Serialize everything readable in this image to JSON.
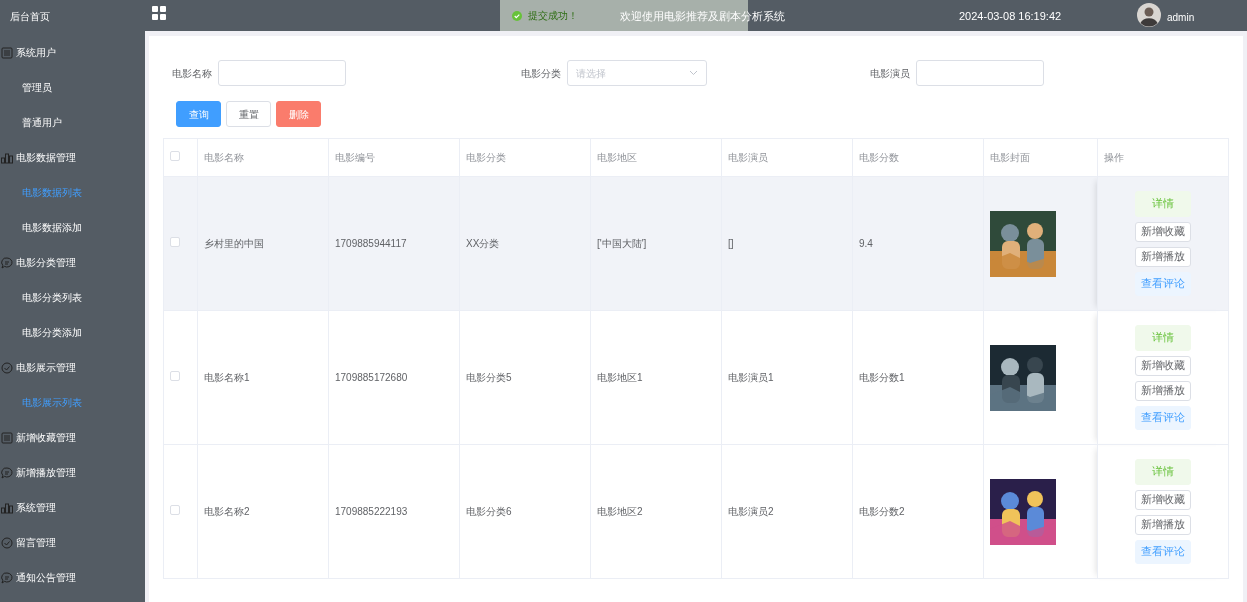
{
  "sidebar": {
    "title": "后台首页",
    "items": [
      {
        "label": "系统用户",
        "kind": "list",
        "children": [
          {
            "label": "管理员",
            "selected": false
          },
          {
            "label": "普通用户",
            "selected": false
          }
        ]
      },
      {
        "label": "电影数据管理",
        "kind": "chart",
        "children": [
          {
            "label": "电影数据列表",
            "selected": true
          },
          {
            "label": "电影数据添加",
            "selected": false
          }
        ]
      },
      {
        "label": "电影分类管理",
        "kind": "chat",
        "children": [
          {
            "label": "电影分类列表",
            "selected": false
          },
          {
            "label": "电影分类添加",
            "selected": false
          }
        ]
      },
      {
        "label": "电影展示管理",
        "kind": "check",
        "children": [
          {
            "label": "电影展示列表",
            "selected": true
          }
        ]
      },
      {
        "label": "新增收藏管理",
        "kind": "list"
      },
      {
        "label": "新增播放管理",
        "kind": "chat"
      },
      {
        "label": "系统管理",
        "kind": "chart"
      },
      {
        "label": "留言管理",
        "kind": "check"
      },
      {
        "label": "通知公告管理",
        "kind": "chat"
      }
    ]
  },
  "topbar": {
    "title": "欢迎使用电影推荐及剧本分析系统",
    "datetime": "2024-03-08 16:19:42",
    "user": "admin"
  },
  "toast": {
    "message": "提交成功！"
  },
  "filters": [
    {
      "label": "电影名称",
      "kind": "input"
    },
    {
      "label": "电影分类",
      "kind": "select",
      "placeholder": "请选择"
    },
    {
      "label": "电影演员",
      "kind": "input"
    }
  ],
  "buttons": [
    {
      "label": "查询",
      "kind": "primary"
    },
    {
      "label": "重置",
      "kind": "default"
    },
    {
      "label": "删除",
      "kind": "danger"
    }
  ],
  "table": {
    "select_all_checked": false,
    "columns": [
      "电影名称",
      "电影编号",
      "电影分类",
      "电影地区",
      "电影演员",
      "电影分数",
      "电影封面",
      "操作"
    ],
    "rows": [
      {
        "checked": false,
        "hovered": true,
        "cells": [
          "乡村里的中国",
          "1709885944117",
          "XX分类",
          "['中国大陆']",
          "[]",
          "9.4"
        ],
        "actions": [
          {
            "label": "详情",
            "kind": "success"
          },
          {
            "label": "新增收藏",
            "kind": "default"
          },
          {
            "label": "新增播放",
            "kind": "default"
          },
          {
            "label": "查看评论",
            "kind": "primary"
          }
        ]
      },
      {
        "checked": false,
        "hovered": false,
        "cells": [
          "电影名称1",
          "1709885172680",
          "电影分类5",
          "电影地区1",
          "电影演员1",
          "电影分数1"
        ],
        "actions": [
          {
            "label": "详情",
            "kind": "success"
          },
          {
            "label": "新增收藏",
            "kind": "default"
          },
          {
            "label": "新增播放",
            "kind": "default"
          },
          {
            "label": "查看评论",
            "kind": "primary"
          }
        ]
      },
      {
        "checked": false,
        "hovered": false,
        "cells": [
          "电影名称2",
          "1709885222193",
          "电影分类6",
          "电影地区2",
          "电影演员2",
          "电影分数2"
        ],
        "actions": [
          {
            "label": "详情",
            "kind": "success"
          },
          {
            "label": "新增收藏",
            "kind": "default"
          },
          {
            "label": "新增播放",
            "kind": "default"
          },
          {
            "label": "查看评论",
            "kind": "primary"
          }
        ]
      }
    ]
  }
}
